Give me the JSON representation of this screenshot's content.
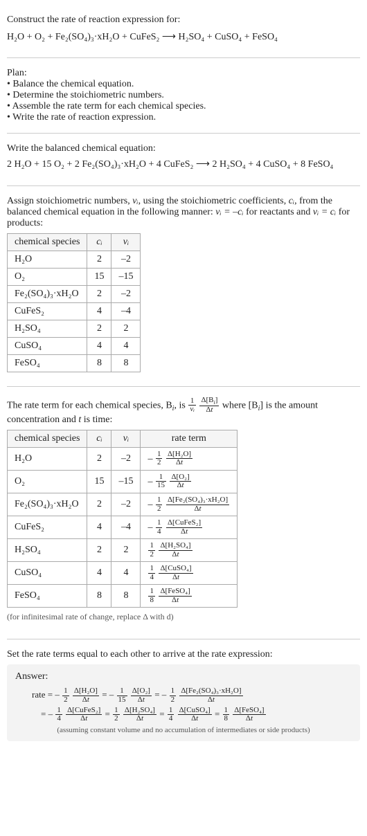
{
  "intro": {
    "line1": "Construct the rate of reaction expression for:",
    "equation": "H₂O + O₂ + Fe₂(SO₄)₃·xH₂O + CuFeS₂  ⟶  H₂SO₄ + CuSO₄ + FeSO₄"
  },
  "plan": {
    "header": "Plan:",
    "items": [
      "Balance the chemical equation.",
      "Determine the stoichiometric numbers.",
      "Assemble the rate term for each chemical species.",
      "Write the rate of reaction expression."
    ]
  },
  "balanced": {
    "header": "Write the balanced chemical equation:",
    "equation": "2 H₂O + 15 O₂ + 2 Fe₂(SO₄)₃·xH₂O + 4 CuFeS₂  ⟶  2 H₂SO₄ + 4 CuSO₄ + 8 FeSO₄"
  },
  "stoich": {
    "intro_a": "Assign stoichiometric numbers, ",
    "intro_b": ", using the stoichiometric coefficients, ",
    "intro_c": ", from the balanced chemical equation in the following manner: ",
    "intro_d": " for reactants and ",
    "intro_e": " for products:",
    "nu_i": "νᵢ",
    "c_i": "cᵢ",
    "rel_react": "νᵢ = –cᵢ",
    "rel_prod": "νᵢ = cᵢ",
    "headers": [
      "chemical species",
      "cᵢ",
      "νᵢ"
    ],
    "rows": [
      {
        "sp": "H₂O",
        "c": "2",
        "v": "–2"
      },
      {
        "sp": "O₂",
        "c": "15",
        "v": "–15"
      },
      {
        "sp": "Fe₂(SO₄)₃·xH₂O",
        "c": "2",
        "v": "–2"
      },
      {
        "sp": "CuFeS₂",
        "c": "4",
        "v": "–4"
      },
      {
        "sp": "H₂SO₄",
        "c": "2",
        "v": "2"
      },
      {
        "sp": "CuSO₄",
        "c": "4",
        "v": "4"
      },
      {
        "sp": "FeSO₄",
        "c": "8",
        "v": "8"
      }
    ]
  },
  "rateterm": {
    "intro_a": "The rate term for each chemical species, B",
    "intro_b": ", is ",
    "intro_c": " where [B",
    "intro_d": "] is the amount concentration and ",
    "intro_e": " is time:",
    "t": "t",
    "headers": [
      "chemical species",
      "cᵢ",
      "νᵢ",
      "rate term"
    ],
    "rows": [
      {
        "sp": "H₂O",
        "c": "2",
        "v": "–2",
        "sign": "–",
        "cnum": "1",
        "cden": "2",
        "dnum": "Δ[H₂O]",
        "dden": "Δt"
      },
      {
        "sp": "O₂",
        "c": "15",
        "v": "–15",
        "sign": "–",
        "cnum": "1",
        "cden": "15",
        "dnum": "Δ[O₂]",
        "dden": "Δt"
      },
      {
        "sp": "Fe₂(SO₄)₃·xH₂O",
        "c": "2",
        "v": "–2",
        "sign": "–",
        "cnum": "1",
        "cden": "2",
        "dnum": "Δ[Fe₂(SO₄)₃·xH₂O]",
        "dden": "Δt"
      },
      {
        "sp": "CuFeS₂",
        "c": "4",
        "v": "–4",
        "sign": "–",
        "cnum": "1",
        "cden": "4",
        "dnum": "Δ[CuFeS₂]",
        "dden": "Δt"
      },
      {
        "sp": "H₂SO₄",
        "c": "2",
        "v": "2",
        "sign": "",
        "cnum": "1",
        "cden": "2",
        "dnum": "Δ[H₂SO₄]",
        "dden": "Δt"
      },
      {
        "sp": "CuSO₄",
        "c": "4",
        "v": "4",
        "sign": "",
        "cnum": "1",
        "cden": "4",
        "dnum": "Δ[CuSO₄]",
        "dden": "Δt"
      },
      {
        "sp": "FeSO₄",
        "c": "8",
        "v": "8",
        "sign": "",
        "cnum": "1",
        "cden": "8",
        "dnum": "Δ[FeSO₄]",
        "dden": "Δt"
      }
    ],
    "note": "(for infinitesimal rate of change, replace Δ with d)"
  },
  "final": {
    "header": "Set the rate terms equal to each other to arrive at the rate expression:",
    "answer_label": "Answer:",
    "rate_prefix": "rate = ",
    "eq": " = ",
    "terms": [
      {
        "sign": "–",
        "cnum": "1",
        "cden": "2",
        "dnum": "Δ[H₂O]",
        "dden": "Δt"
      },
      {
        "sign": "–",
        "cnum": "1",
        "cden": "15",
        "dnum": "Δ[O₂]",
        "dden": "Δt"
      },
      {
        "sign": "–",
        "cnum": "1",
        "cden": "2",
        "dnum": "Δ[Fe₂(SO₄)₃·xH₂O]",
        "dden": "Δt"
      },
      {
        "sign": "–",
        "cnum": "1",
        "cden": "4",
        "dnum": "Δ[CuFeS₂]",
        "dden": "Δt"
      },
      {
        "sign": "",
        "cnum": "1",
        "cden": "2",
        "dnum": "Δ[H₂SO₄]",
        "dden": "Δt"
      },
      {
        "sign": "",
        "cnum": "1",
        "cden": "4",
        "dnum": "Δ[CuSO₄]",
        "dden": "Δt"
      },
      {
        "sign": "",
        "cnum": "1",
        "cden": "8",
        "dnum": "Δ[FeSO₄]",
        "dden": "Δt"
      }
    ],
    "assume": "(assuming constant volume and no accumulation of intermediates or side products)"
  }
}
